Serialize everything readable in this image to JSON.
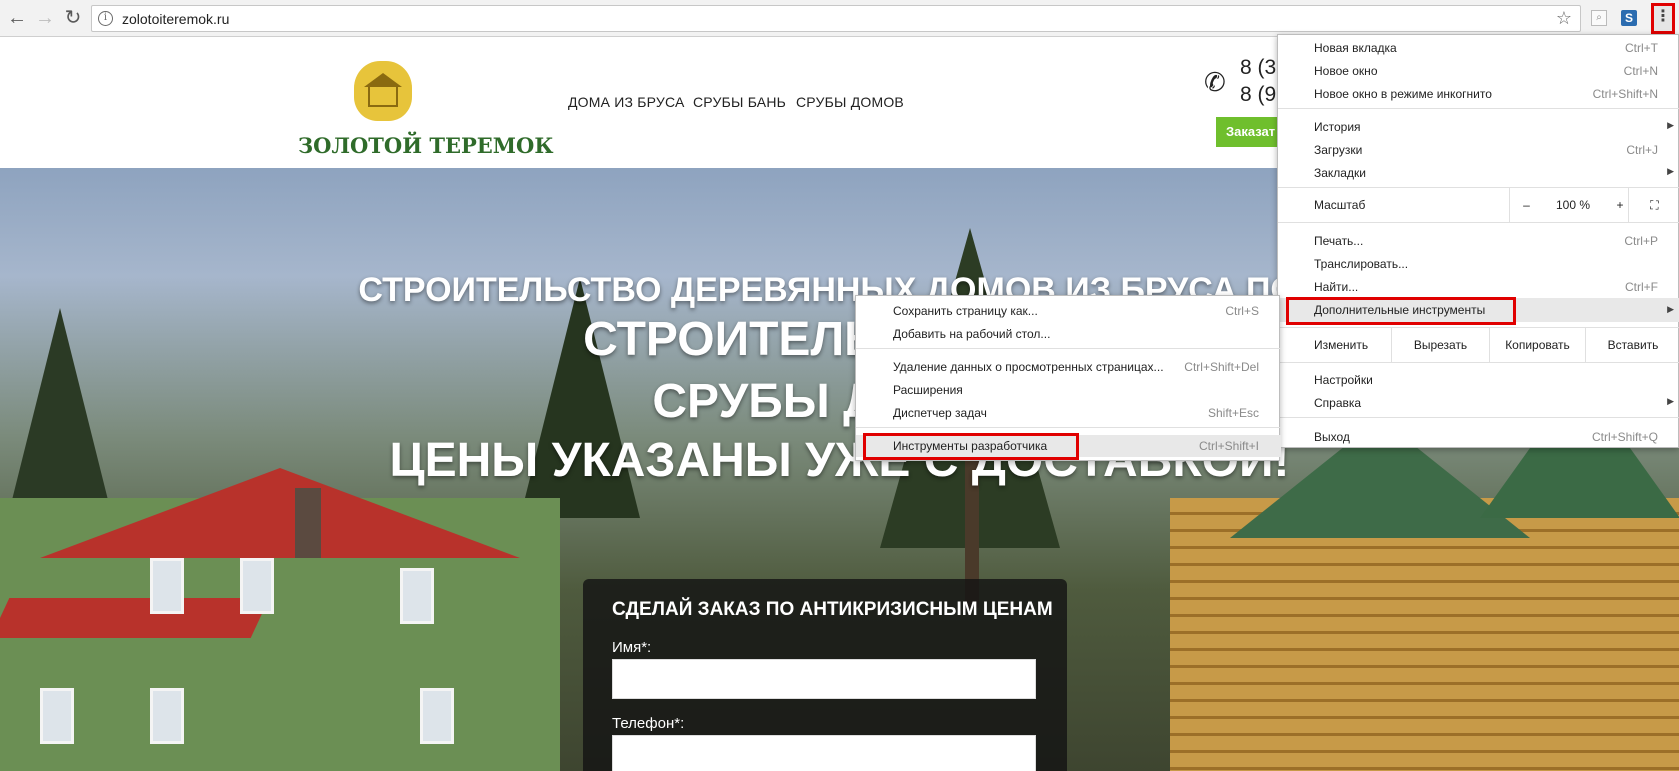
{
  "browser": {
    "url": "zolotoiteremok.ru",
    "back_icon": "arrow-left-icon",
    "forward_icon": "arrow-right-icon",
    "reload_icon": "reload-icon",
    "menu_icon": "kebab-menu-icon"
  },
  "site": {
    "logo_text": "ЗОЛОТОЙ ТЕРЕМОК",
    "nav": [
      "ДОМА ИЗ БРУСА",
      "СРУБЫ БАНЬ",
      "СРУБЫ ДОМОВ"
    ],
    "phone1": "8 (3",
    "phone2": "8 (9",
    "order_button": "Заказат"
  },
  "hero": {
    "line1": "СТРОИТЕЛЬСТВО ДЕРЕВЯННЫХ ДОМОВ ИЗ БРУСА ПОД",
    "line2": "СТРОИТЕЛЬСТВО ДО",
    "line3": "СРУБЫ ДОМОВ",
    "line4": "ЦЕНЫ УКАЗАНЫ УЖЕ С ДОСТАВКОЙ!"
  },
  "form": {
    "title": "СДЕЛАЙ ЗАКАЗ ПО АНТИКРИЗИСНЫМ ЦЕНАМ",
    "name_label": "Имя*:",
    "phone_label": "Телефон*:"
  },
  "menu": {
    "new_tab": {
      "label": "Новая вкладка",
      "shortcut": "Ctrl+T"
    },
    "new_window": {
      "label": "Новое окно",
      "shortcut": "Ctrl+N"
    },
    "incognito": {
      "label": "Новое окно в режиме инкогнито",
      "shortcut": "Ctrl+Shift+N"
    },
    "history": {
      "label": "История"
    },
    "downloads": {
      "label": "Загрузки",
      "shortcut": "Ctrl+J"
    },
    "bookmarks": {
      "label": "Закладки"
    },
    "zoom": {
      "label": "Масштаб",
      "minus": "–",
      "value": "100 %",
      "plus": "+"
    },
    "print": {
      "label": "Печать...",
      "shortcut": "Ctrl+P"
    },
    "cast": {
      "label": "Транслировать..."
    },
    "find": {
      "label": "Найти...",
      "shortcut": "Ctrl+F"
    },
    "more_tools": {
      "label": "Дополнительные инструменты"
    },
    "edit": {
      "label": "Изменить",
      "cut": "Вырезать",
      "copy": "Копировать",
      "paste": "Вставить"
    },
    "settings": {
      "label": "Настройки"
    },
    "help": {
      "label": "Справка"
    },
    "exit": {
      "label": "Выход",
      "shortcut": "Ctrl+Shift+Q"
    }
  },
  "submenu": {
    "save_page": {
      "label": "Сохранить страницу как...",
      "shortcut": "Ctrl+S"
    },
    "add_desktop": {
      "label": "Добавить на рабочий стол..."
    },
    "clear_data": {
      "label": "Удаление данных о просмотренных страницах...",
      "shortcut": "Ctrl+Shift+Del"
    },
    "extensions": {
      "label": "Расширения"
    },
    "task_manager": {
      "label": "Диспетчер задач",
      "shortcut": "Shift+Esc"
    },
    "devtools": {
      "label": "Инструменты разработчика",
      "shortcut": "Ctrl+Shift+I"
    }
  },
  "colors": {
    "highlight": "#e00000",
    "order_button": "#6fbf2d",
    "logo_text": "#2f6b2a"
  }
}
